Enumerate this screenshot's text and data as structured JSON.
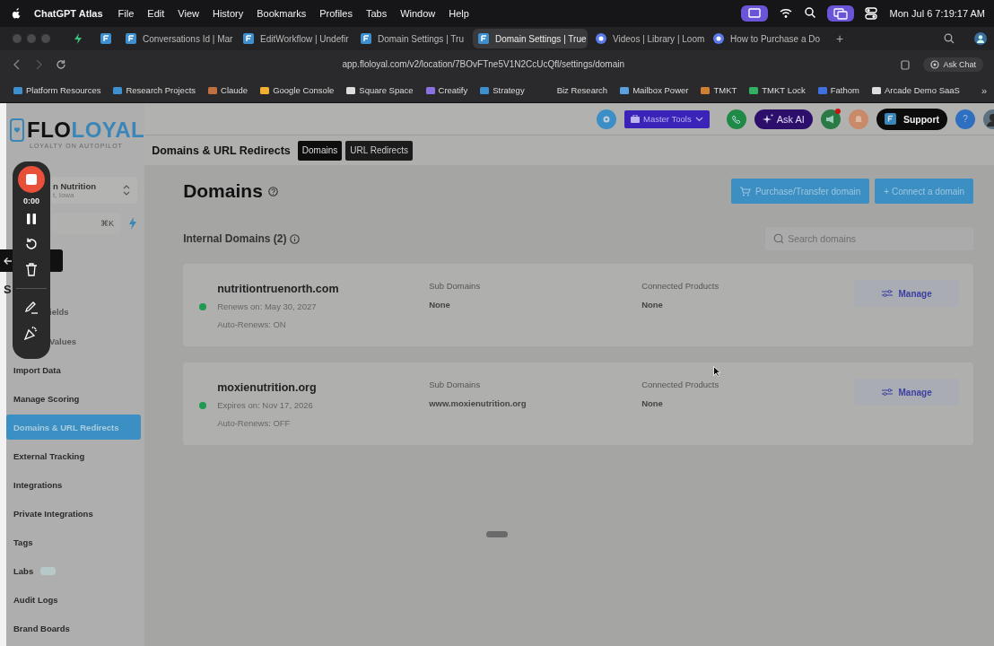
{
  "menu_bar": {
    "app": "ChatGPT Atlas",
    "menus": [
      "File",
      "Edit",
      "View",
      "History",
      "Bookmarks",
      "Profiles",
      "Tabs",
      "Window",
      "Help"
    ],
    "clock": "Mon Jul 6  7:19:17 AM"
  },
  "browser_tabs": [
    {
      "title": "Conversations Id | Mar",
      "selected": false
    },
    {
      "title": "EditWorkflow | Undefir",
      "selected": false
    },
    {
      "title": "Domain Settings | Tru",
      "selected": false
    },
    {
      "title": "Domain Settings | True",
      "selected": true
    },
    {
      "title": "Videos | Library | Loom",
      "selected": false
    },
    {
      "title": "How to Purchase a Do",
      "selected": false
    }
  ],
  "new_tab": "+",
  "address_bar": {
    "url": "app.floloyal.com/v2/location/7BOvFTne5V1N2CcUcQfl/settings/domain",
    "ask_chat": "Ask Chat"
  },
  "bookmarks": [
    "Platform Resources",
    "Research Projects",
    "Claude",
    "Google Console",
    "Square Space",
    "Creatify",
    "Strategy",
    "Biz Research",
    "Mailbox Power",
    "TMKT",
    "TMKT Lock",
    "Fathom",
    "Arcade Demo SaaS"
  ],
  "bookmarks_more": "»",
  "sidebar": {
    "logo": {
      "dark": "FLO",
      "accent": "LOYAL",
      "tagline": "LOYALTY ON AUTOPILOT"
    },
    "location": {
      "name": "n Nutrition",
      "city": "t, Iowa"
    },
    "search": {
      "shortcut": "⌘K"
    },
    "heading": "S",
    "items": [
      {
        "label": "ields",
        "selected": false,
        "new_badge": false,
        "kind": "clipped"
      },
      {
        "label": "Values",
        "selected": false,
        "new_badge": false,
        "kind": "clipped"
      },
      {
        "label": "Import Data",
        "selected": false,
        "new_badge": false
      },
      {
        "label": "Manage Scoring",
        "selected": false,
        "new_badge": false
      },
      {
        "label": "Domains & URL Redirects",
        "selected": true,
        "new_badge": false
      },
      {
        "label": "External Tracking",
        "selected": false,
        "new_badge": false
      },
      {
        "label": "Integrations",
        "selected": false,
        "new_badge": false
      },
      {
        "label": "Private Integrations",
        "selected": false,
        "new_badge": false
      },
      {
        "label": "Tags",
        "selected": false,
        "new_badge": false
      },
      {
        "label": "Labs",
        "selected": false,
        "new_badge": true
      },
      {
        "label": "Audit Logs",
        "selected": false,
        "new_badge": false
      },
      {
        "label": "Brand Boards",
        "selected": false,
        "new_badge": false
      }
    ]
  },
  "top_bar": {
    "master_tools": "Master Tools",
    "ask_ai": "Ask AI",
    "announcements_alert": true,
    "support": "Support",
    "help": "?"
  },
  "page_header": {
    "title": "Domains & URL Redirects",
    "tabs": [
      {
        "label": "Domains",
        "selected": true
      },
      {
        "label": "URL Redirects",
        "selected": false
      }
    ]
  },
  "domains": {
    "title": "Domains",
    "purchase_button": "Purchase/Transfer domain",
    "connect_button": "+ Connect a domain",
    "section_title": "Internal Domains (2)",
    "search": {
      "placeholder": "Search domains"
    },
    "items": [
      {
        "name": "nutritiontruenorth.com",
        "active": true,
        "date": "Renews on: May 30, 2027",
        "auto_renew": "Auto-Renews: ON",
        "sub_label": "Sub Domains",
        "sub_value": "None",
        "products_label": "Connected Products",
        "products_value": "None",
        "action": "Manage"
      },
      {
        "name": "moxienutrition.org",
        "active": true,
        "date": "Expires on: Nov 17, 2026",
        "auto_renew": "Auto-Renews: OFF",
        "sub_label": "Sub Domains",
        "sub_value": "www.moxienutrition.org",
        "products_label": "Connected Products",
        "products_value": "None",
        "action": "Manage"
      }
    ]
  },
  "recorder": {
    "timer": "0:00"
  }
}
